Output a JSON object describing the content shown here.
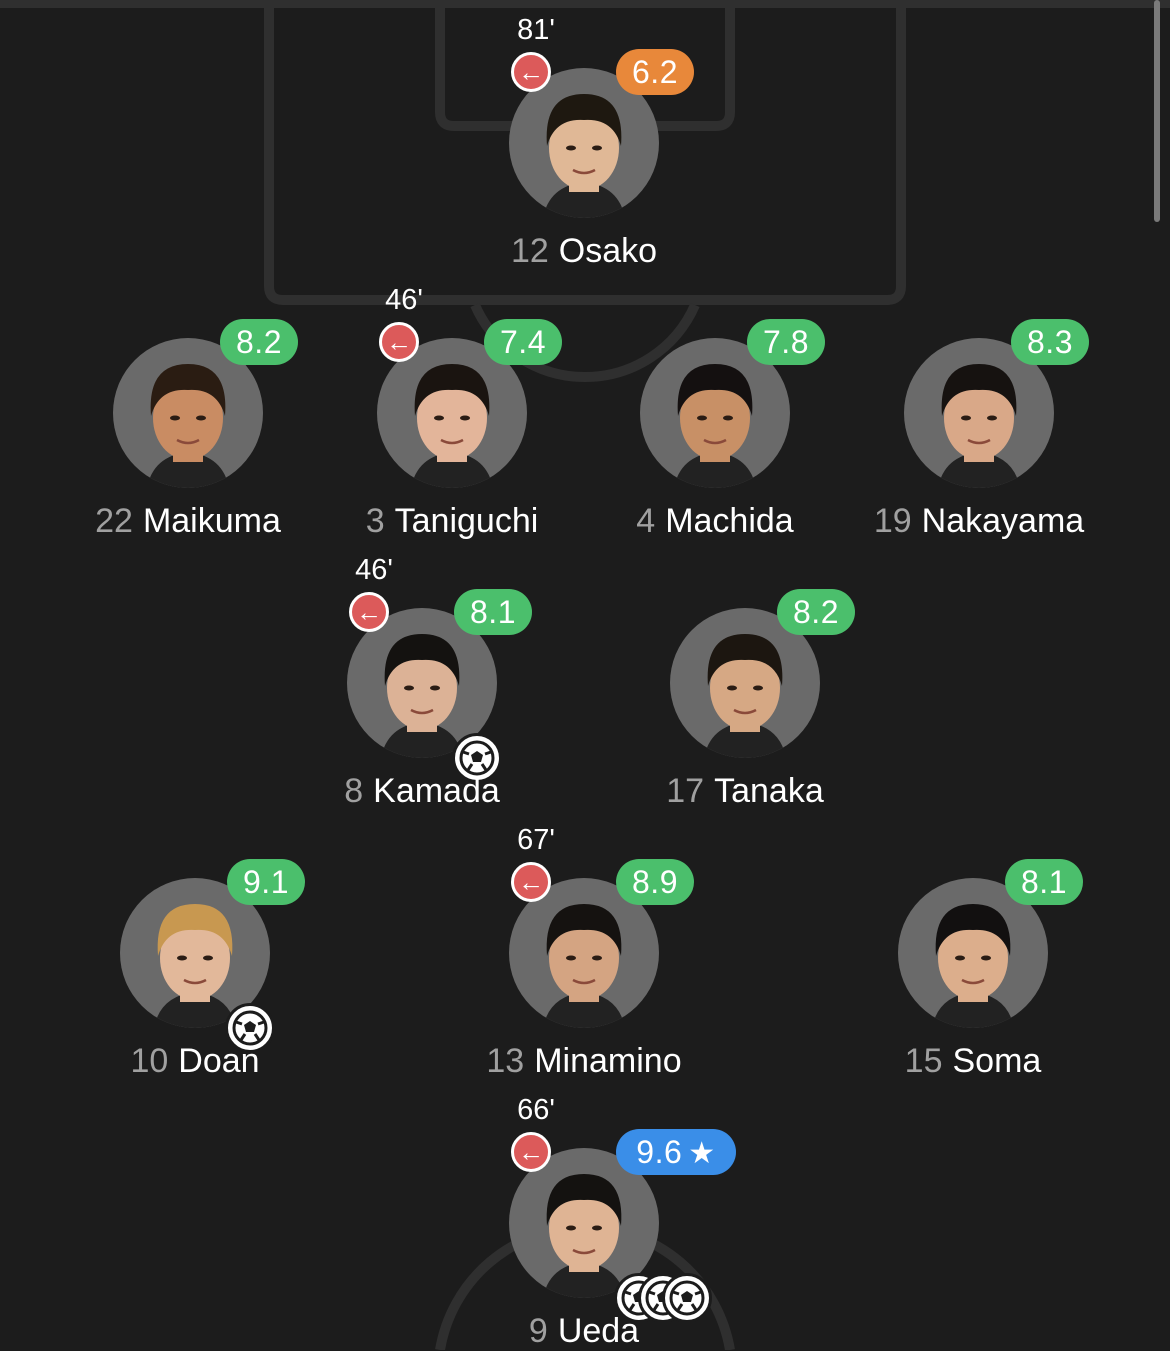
{
  "lineup": {
    "players": [
      {
        "number": "12",
        "name": "Osako",
        "rating": "6.2",
        "rating_color": "orange",
        "sub_minute": "81'",
        "goals": 0,
        "skin": "#e0b896",
        "hair": "#1e1810"
      },
      {
        "number": "22",
        "name": "Maikuma",
        "rating": "8.2",
        "rating_color": "green",
        "sub_minute": "",
        "goals": 0,
        "skin": "#c98c63",
        "hair": "#2a1c12"
      },
      {
        "number": "3",
        "name": "Taniguchi",
        "rating": "7.4",
        "rating_color": "green",
        "sub_minute": "46'",
        "goals": 0,
        "skin": "#e3b59a",
        "hair": "#1a1410"
      },
      {
        "number": "4",
        "name": "Machida",
        "rating": "7.8",
        "rating_color": "green",
        "sub_minute": "",
        "goals": 0,
        "skin": "#c89066",
        "hair": "#141010"
      },
      {
        "number": "19",
        "name": "Nakayama",
        "rating": "8.3",
        "rating_color": "green",
        "sub_minute": "",
        "goals": 0,
        "skin": "#d9a888",
        "hair": "#161210"
      },
      {
        "number": "8",
        "name": "Kamada",
        "rating": "8.1",
        "rating_color": "green",
        "sub_minute": "46'",
        "goals": 1,
        "skin": "#dcb296",
        "hair": "#141210"
      },
      {
        "number": "17",
        "name": "Tanaka",
        "rating": "8.2",
        "rating_color": "green",
        "sub_minute": "",
        "goals": 0,
        "skin": "#d6a884",
        "hair": "#1c1610"
      },
      {
        "number": "10",
        "name": "Doan",
        "rating": "9.1",
        "rating_color": "green",
        "sub_minute": "",
        "goals": 1,
        "skin": "#e2b89a",
        "hair": "#c89850"
      },
      {
        "number": "13",
        "name": "Minamino",
        "rating": "8.9",
        "rating_color": "green",
        "sub_minute": "67'",
        "goals": 0,
        "skin": "#d4a482",
        "hair": "#151210"
      },
      {
        "number": "15",
        "name": "Soma",
        "rating": "8.1",
        "rating_color": "green",
        "sub_minute": "",
        "goals": 0,
        "skin": "#dcae8c",
        "hair": "#121010"
      },
      {
        "number": "9",
        "name": "Ueda",
        "rating": "9.6",
        "rating_color": "blue",
        "sub_minute": "66'",
        "goals": 3,
        "star": "★",
        "skin": "#dfb494",
        "hair": "#141210"
      }
    ]
  },
  "colors": {
    "background": "#1c1c1c",
    "pitch_lines": "#2f2f2f",
    "rating_green": "#4bbf6c",
    "rating_orange": "#e8883a",
    "rating_blue": "#3a8ee8",
    "sub_red": "#dc5a5a"
  },
  "icons": {
    "substitution": "arrow-left-icon",
    "goal": "football-icon",
    "player_of_match": "star-icon"
  }
}
